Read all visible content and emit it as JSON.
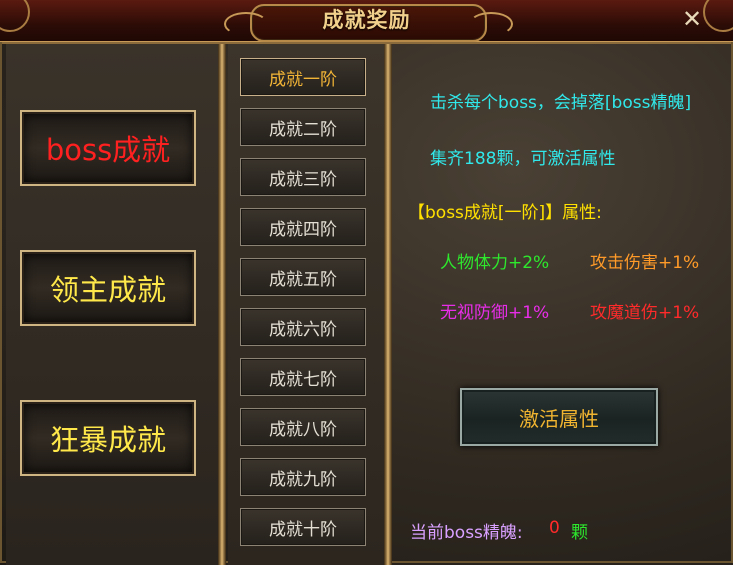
{
  "window": {
    "title": "成就奖励",
    "close_label": "✕"
  },
  "categories": [
    {
      "label": "boss成就",
      "active": true
    },
    {
      "label": "领主成就",
      "active": false
    },
    {
      "label": "狂暴成就",
      "active": false
    }
  ],
  "tiers": [
    {
      "label": "成就一阶",
      "active": true
    },
    {
      "label": "成就二阶"
    },
    {
      "label": "成就三阶"
    },
    {
      "label": "成就四阶"
    },
    {
      "label": "成就五阶"
    },
    {
      "label": "成就六阶"
    },
    {
      "label": "成就七阶"
    },
    {
      "label": "成就八阶"
    },
    {
      "label": "成就九阶"
    },
    {
      "label": "成就十阶"
    }
  ],
  "info": {
    "desc_line1": "击杀每个boss，会掉落[boss精魄]",
    "desc_line2": "集齐188颗，可激活属性",
    "attr_header": "【boss成就[一阶]】属性:",
    "attrs": {
      "stamina": "人物体力+2%",
      "attack_damage": "攻击伤害+1%",
      "ignore_defense": "无视防御+1%",
      "magic_damage": "攻魔道伤+1%"
    },
    "activate_label": "激活属性",
    "essence_label": "当前boss精魄:",
    "essence_count": "0",
    "essence_unit": "颗"
  },
  "colors": {
    "cyan": "#30e8ea",
    "yellow": "#ffe000",
    "green": "#2de82d",
    "orange": "#ff9a28",
    "magenta": "#e82de8",
    "red": "#ff2a2a",
    "lilac": "#d9a0ff",
    "active_category": "#ff2020",
    "inactive_category": "#ffe94a",
    "active_tier": "#f1b436"
  }
}
